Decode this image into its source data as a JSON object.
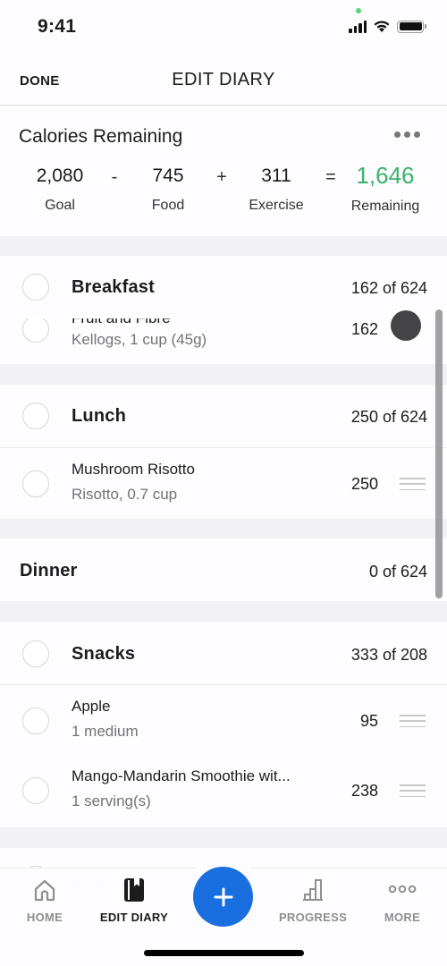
{
  "status_bar": {
    "time": "9:41"
  },
  "nav": {
    "done_label": "DONE",
    "title": "EDIT DIARY"
  },
  "calories": {
    "title": "Calories Remaining",
    "goal": {
      "value": "2,080",
      "label": "Goal"
    },
    "minus": "-",
    "food": {
      "value": "745",
      "label": "Food"
    },
    "plus": "+",
    "exercise": {
      "value": "311",
      "label": "Exercise"
    },
    "equals": "=",
    "remaining": {
      "value": "1,646",
      "label": "Remaining"
    },
    "accent_color": "#3bb36a"
  },
  "meals": [
    {
      "name": "Breakfast",
      "total": "162 of 624",
      "items": [
        {
          "name": "Fruit and Fibre",
          "desc": "Kellogs, 1 cup (45g)",
          "calories": "162"
        }
      ]
    },
    {
      "name": "Lunch",
      "total": "250 of 624",
      "items": [
        {
          "name": "Mushroom Risotto",
          "desc": "Risotto, 0.7 cup",
          "calories": "250"
        }
      ]
    },
    {
      "name": "Dinner",
      "total": "0 of 624",
      "items": []
    },
    {
      "name": "Snacks",
      "total": "333 of 208",
      "items": [
        {
          "name": "Apple",
          "desc": "1 medium",
          "calories": "95"
        },
        {
          "name": "Mango-Mandarin Smoothie wit...",
          "desc": "1 serving(s)",
          "calories": "238"
        }
      ]
    },
    {
      "name": "Exercise"
    }
  ],
  "tab_bar": {
    "tabs": [
      {
        "label": "HOME",
        "icon": "home-icon"
      },
      {
        "label": "EDIT DIARY",
        "icon": "diary-icon",
        "active": true
      },
      {
        "label": "PROGRESS",
        "icon": "bar-chart-icon"
      },
      {
        "label": "MORE",
        "icon": "more-dots-icon"
      }
    ],
    "add_label": "+",
    "add_color": "#1a6fe0"
  }
}
